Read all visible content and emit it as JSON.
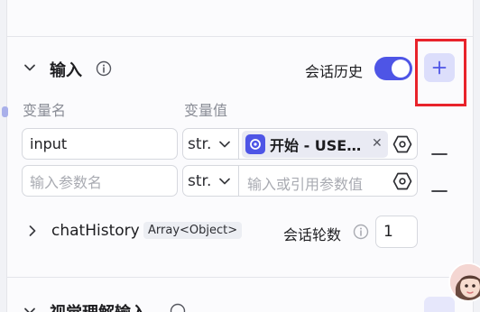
{
  "input_section": {
    "title": "输入",
    "history_label": "会话历史",
    "history_enabled": true,
    "add_icon": "plus-icon",
    "info_icon": "info-icon"
  },
  "columns": {
    "name_header": "变量名",
    "value_header": "变量值"
  },
  "rows": [
    {
      "name": "input",
      "type": "str.",
      "ref_chip": "开始 - USE…",
      "ref_icon": "start-node-icon"
    },
    {
      "name_placeholder": "输入参数名",
      "type": "str.",
      "ref_placeholder": "输入或引用参数值"
    }
  ],
  "chat_history": {
    "name": "chatHistory",
    "type_tag": "Array<Object>",
    "rounds_label": "会话轮数",
    "rounds_value": "1"
  },
  "next_section": {
    "title": "视觉理解输入"
  },
  "colors": {
    "accent": "#4e55e6",
    "highlight": "#e8232b"
  }
}
